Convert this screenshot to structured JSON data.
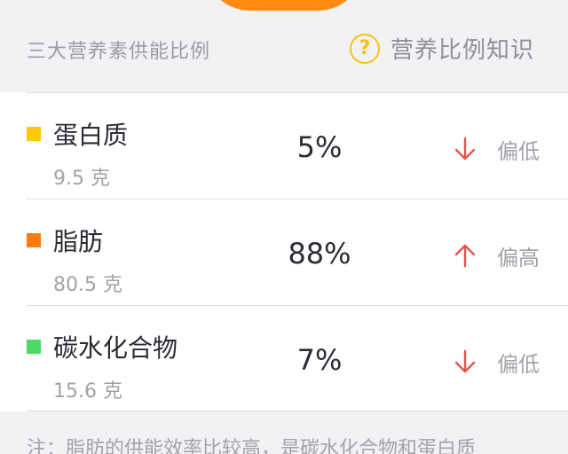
{
  "header": {
    "title": "三大营养素供能比例",
    "help_icon": "question-circle-icon",
    "help_label": "营养比例知识"
  },
  "colors": {
    "protein": "#ffc90a",
    "fat": "#ff7a0f",
    "carbs": "#4cd964",
    "arrow": "#e2574c",
    "help": "#f3c21a",
    "donut": "#ff8a12"
  },
  "nutrients": [
    {
      "name": "蛋白质",
      "amount": "9.5 克",
      "percent": "5%",
      "trend_icon": "arrow-down-icon",
      "status": "偏低"
    },
    {
      "name": "脂肪",
      "amount": "80.5 克",
      "percent": "88%",
      "trend_icon": "arrow-up-icon",
      "status": "偏高"
    },
    {
      "name": "碳水化合物",
      "amount": "15.6 克",
      "percent": "7%",
      "trend_icon": "arrow-down-icon",
      "status": "偏低"
    }
  ],
  "footnote": "注：脂肪的供能效率比较高，是碳水化合物和蛋白质"
}
